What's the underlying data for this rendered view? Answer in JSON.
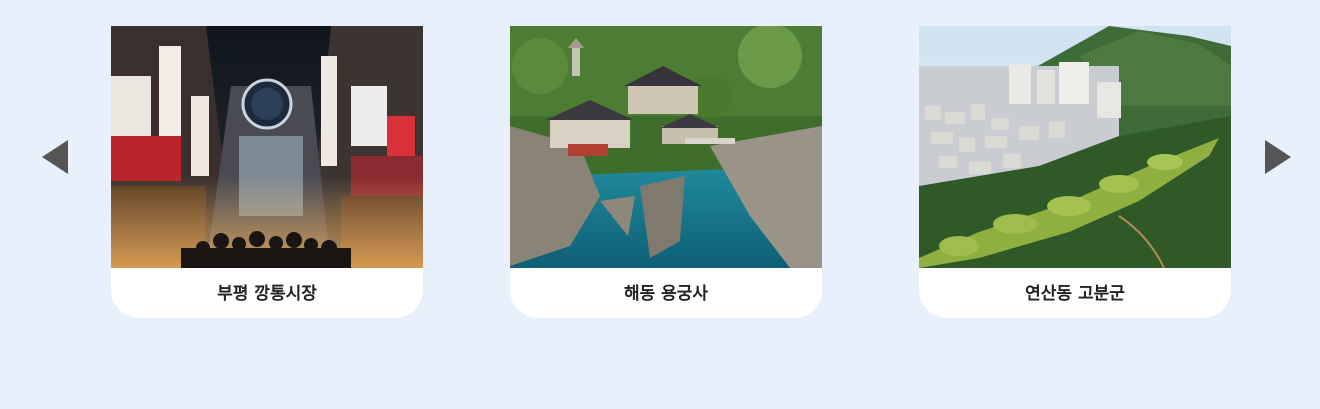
{
  "carousel": {
    "prev_icon": "triangle-left-icon",
    "next_icon": "triangle-right-icon",
    "cards": [
      {
        "caption": "부평 깡통시장"
      },
      {
        "caption": "해동 용궁사"
      },
      {
        "caption": "연산동 고분군"
      }
    ]
  },
  "colors": {
    "background": "#e8f1fb",
    "card": "#ffffff",
    "arrow": "#555555",
    "caption_text": "#222222"
  }
}
